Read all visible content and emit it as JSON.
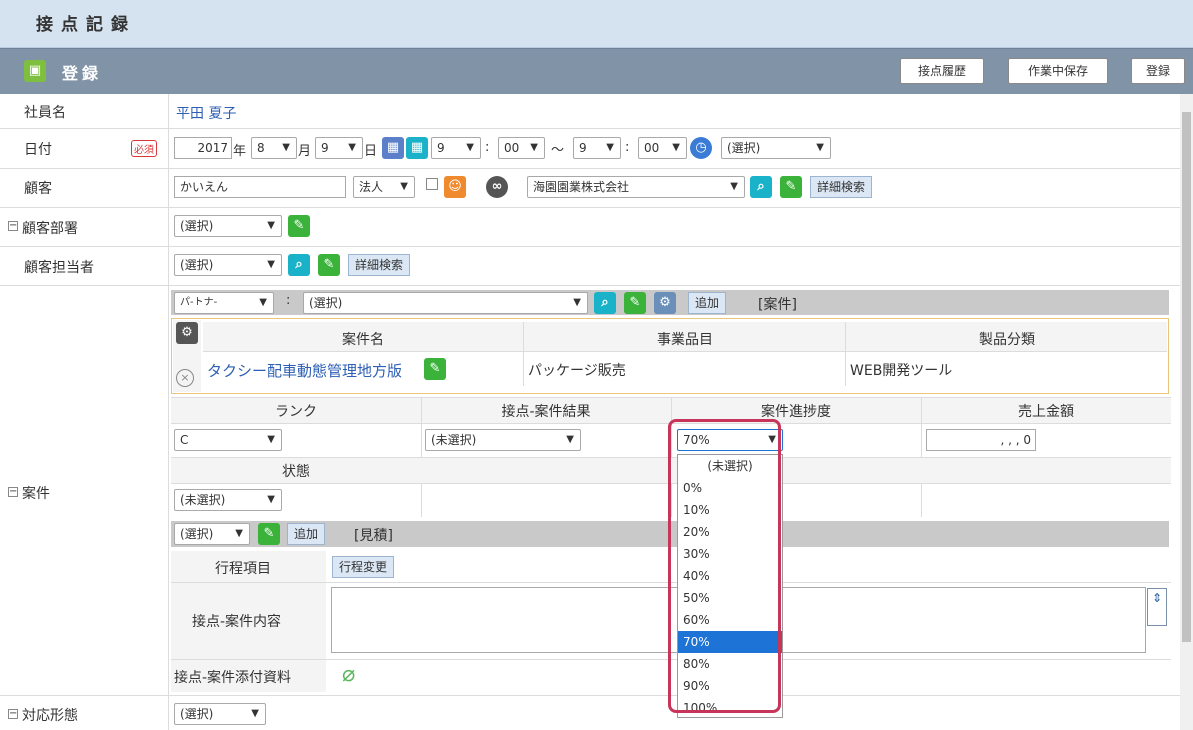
{
  "page": {
    "title": "接点記録"
  },
  "section": {
    "title": "登録",
    "icon": "camera-icon"
  },
  "header_buttons": {
    "history": "接点履歴",
    "draft_save": "作業中保存",
    "register": "登録"
  },
  "rows": {
    "employee": {
      "label": "社員名",
      "value": "平田 夏子"
    },
    "date": {
      "label": "日付",
      "required": "必須",
      "year": "2017",
      "year_unit": "年",
      "month": "8",
      "month_unit": "月",
      "day": "9",
      "day_unit": "日",
      "start_hour": "9",
      "colon": ":",
      "start_min": "00",
      "tilde": "〜",
      "end_hour": "9",
      "end_min": "00",
      "option": "(選択)"
    },
    "customer": {
      "label": "顧客",
      "text": "かいえん",
      "type": "法人",
      "company": "海園園業株式会社",
      "detail_search": "詳細検索"
    },
    "customer_dept": {
      "label": "顧客部署",
      "select": "(選択)"
    },
    "customer_person": {
      "label": "顧客担当者",
      "select": "(選択)",
      "detail_search": "詳細検索"
    },
    "project": {
      "label": "案件",
      "partner_select": "パ-トナ-",
      "colon": ":",
      "select": "(選択)",
      "add": "追加",
      "tag": "[案件]",
      "table": {
        "headers": [
          "案件名",
          "事業品目",
          "製品分類"
        ],
        "row": [
          "タクシー配車動態管理地方版",
          "パッケージ販売",
          "WEB開発ツール"
        ]
      },
      "grid_headers": [
        "ランク",
        "接点-案件結果",
        "案件進捗度",
        "売上金額"
      ],
      "rank": "C",
      "result": "(未選択)",
      "progress": "70%",
      "amount": ",   ,   ,  0",
      "status_header": "状態",
      "status": "(未選択)",
      "estimate_select": "(選択)",
      "estimate_add": "追加",
      "estimate_tag": "[見積]",
      "schedule_label": "行程項目",
      "schedule_change": "行程変更",
      "content_label": "接点-案件内容",
      "attachment_label": "接点-案件添付資料"
    },
    "response": {
      "label": "対応形態",
      "select": "(選択)"
    }
  },
  "dropdown": {
    "options": [
      "(未選択)",
      "0%",
      "10%",
      "20%",
      "30%",
      "40%",
      "50%",
      "60%",
      "70%",
      "80%",
      "90%",
      "100%"
    ],
    "selected": "70%"
  },
  "colors": {
    "header_bg": "#8193a7",
    "title_bg": "#d5e3f1",
    "highlight": "#c8355a",
    "selected": "#1e73d6"
  }
}
